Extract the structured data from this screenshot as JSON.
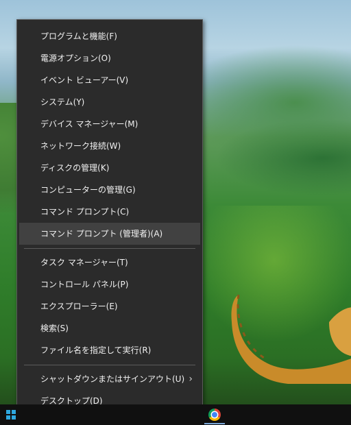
{
  "menu": {
    "items": [
      {
        "label": "プログラムと機能(F)"
      },
      {
        "label": "電源オプション(O)"
      },
      {
        "label": "イベント ビューアー(V)"
      },
      {
        "label": "システム(Y)"
      },
      {
        "label": "デバイス マネージャー(M)"
      },
      {
        "label": "ネットワーク接続(W)"
      },
      {
        "label": "ディスクの管理(K)"
      },
      {
        "label": "コンピューターの管理(G)"
      },
      {
        "label": "コマンド プロンプト(C)"
      },
      {
        "label": "コマンド プロンプト (管理者)(A)"
      },
      {
        "label": "タスク マネージャー(T)"
      },
      {
        "label": "コントロール パネル(P)"
      },
      {
        "label": "エクスプローラー(E)"
      },
      {
        "label": "検索(S)"
      },
      {
        "label": "ファイル名を指定して実行(R)"
      },
      {
        "label": "シャットダウンまたはサインアウト(U)"
      },
      {
        "label": "デスクトップ(D)"
      }
    ],
    "hovered_item": "コマンド プロンプト (管理者)(A)",
    "submenu_chevron": "chevron-right-icon"
  },
  "taskbar": {
    "start_icon": "windows-logo-icon",
    "pinned_icon": "chrome-icon"
  },
  "colors": {
    "menu_bg": "#2b2b2b",
    "menu_hover": "#414141",
    "menu_text": "#f2f2f2",
    "taskbar_bg": "#101010",
    "windows_logo": "#2ea8e0"
  }
}
